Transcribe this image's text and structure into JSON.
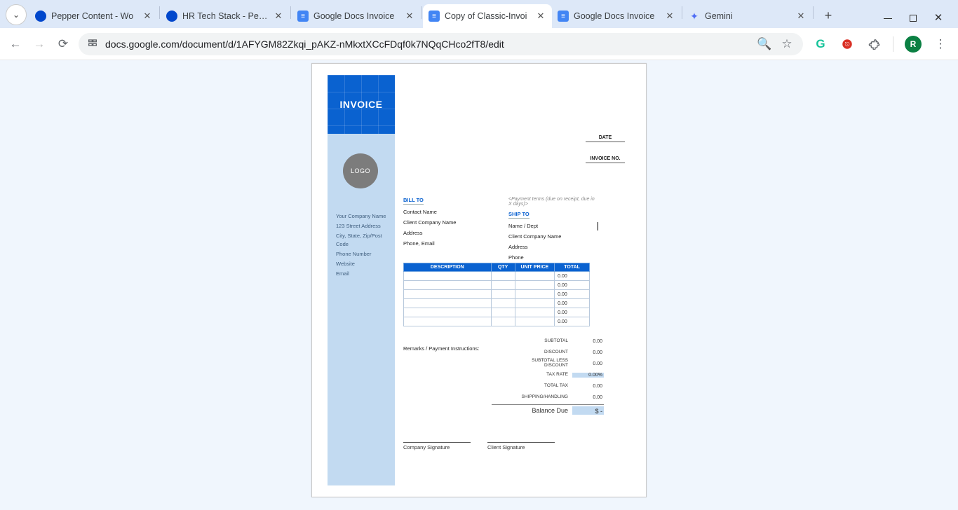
{
  "browser": {
    "tabs": [
      {
        "title": "Pepper Content - Wo",
        "fav_bg": "#0047cc",
        "fav_text": ""
      },
      {
        "title": "HR Tech Stack - Pepp",
        "fav_bg": "#0047cc",
        "fav_text": ""
      },
      {
        "title": "Google Docs Invoice",
        "fav_bg": "#4285f4",
        "fav_text": "≡"
      },
      {
        "title": "Copy of Classic-Invoi",
        "fav_bg": "#4285f4",
        "fav_text": "≡",
        "active": true
      },
      {
        "title": "Google Docs Invoice",
        "fav_bg": "#4285f4",
        "fav_text": "≡"
      },
      {
        "title": "Gemini",
        "fav_bg": "transparent",
        "fav_text": "✦",
        "fav_color": "#4f6df5"
      }
    ],
    "url": "docs.google.com/document/d/1AFYGM82Zkqi_pAKZ-nMkxtXCcFDqf0k7NQqCHco2fT8/edit",
    "avatar_letter": "R"
  },
  "doc": {
    "invoice_label": "INVOICE",
    "logo_label": "LOGO",
    "meta": {
      "date_label": "DATE",
      "invoice_no_label": "INVOICE NO."
    },
    "company": {
      "name": "Your Company Name",
      "addr1": "123 Street Address",
      "addr2": "City, State, Zip/Post Code",
      "phone": "Phone Number",
      "web": "Website",
      "email": "Email"
    },
    "bill_to": {
      "header": "BILL TO",
      "contact": "Contact Name",
      "company": "Client Company Name",
      "address": "Address",
      "phone_email": "Phone, Email"
    },
    "ship_to": {
      "payment_terms": "<Payment terms (due on receipt, due in X days)>",
      "header": "SHIP TO",
      "name": "Name / Dept",
      "company": "Client Company Name",
      "address": "Address",
      "phone": "Phone"
    },
    "table": {
      "headers": {
        "desc": "DESCRIPTION",
        "qty": "QTY",
        "unit": "UNIT PRICE",
        "total": "TOTAL"
      },
      "rows": [
        {
          "total": "0.00"
        },
        {
          "total": "0.00"
        },
        {
          "total": "0.00"
        },
        {
          "total": "0.00"
        },
        {
          "total": "0.00"
        },
        {
          "total": "0.00"
        }
      ]
    },
    "remarks_label": "Remarks / Payment Instructions:",
    "totals": {
      "subtotal": {
        "label": "SUBTOTAL",
        "value": "0.00"
      },
      "discount": {
        "label": "DISCOUNT",
        "value": "0.00"
      },
      "sub_less": {
        "label": "SUBTOTAL LESS DISCOUNT",
        "value": "0.00"
      },
      "tax_rate": {
        "label": "TAX RATE",
        "value": "0.00%"
      },
      "total_tax": {
        "label": "TOTAL TAX",
        "value": "0.00"
      },
      "shipping": {
        "label": "SHIPPING/HANDLING",
        "value": "0.00"
      },
      "balance": {
        "label": "Balance Due",
        "value": "$ -"
      }
    },
    "signatures": {
      "company": "Company Signature",
      "client": "Client Signature"
    }
  }
}
